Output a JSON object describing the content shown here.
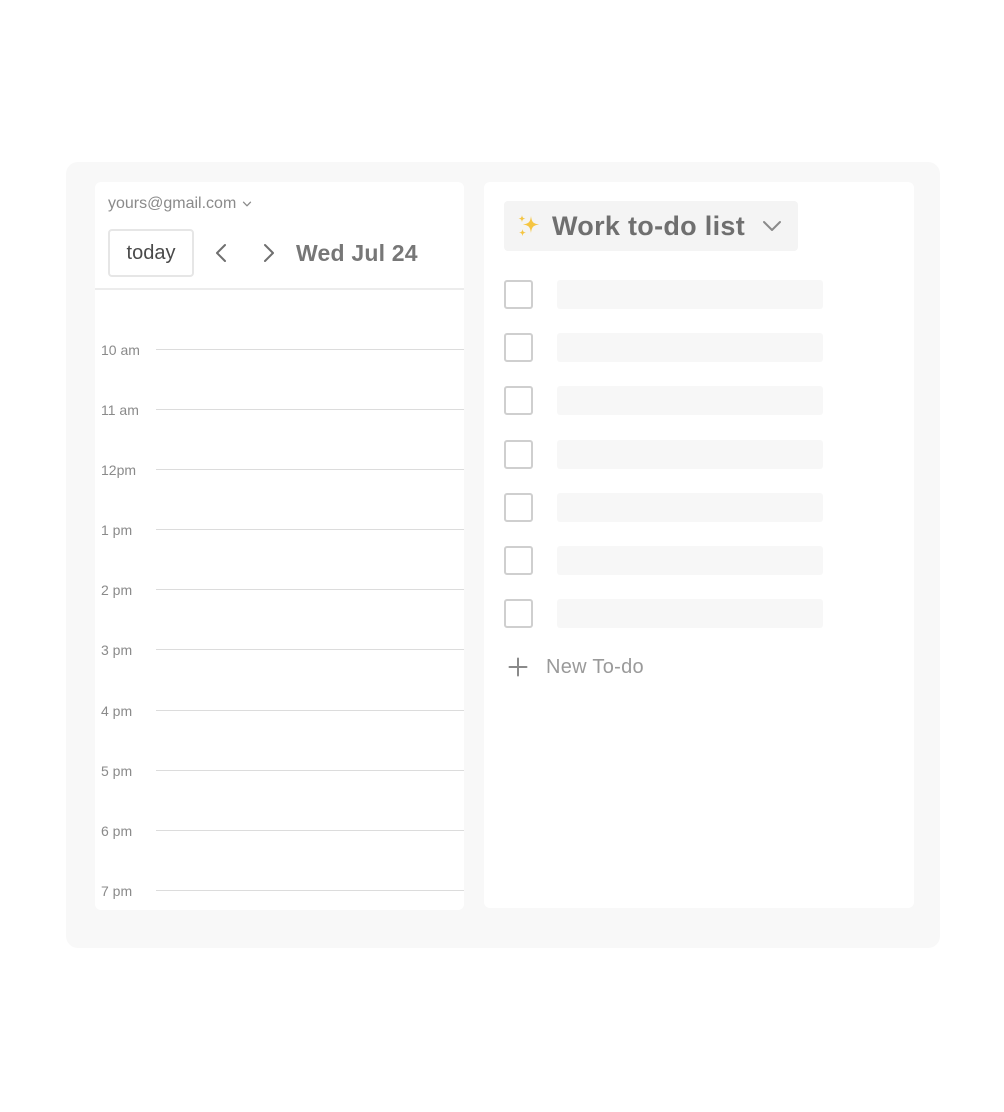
{
  "calendar": {
    "account": "yours@gmail.com",
    "today_label": "today",
    "date_label": "Wed Jul 24",
    "hours": [
      "10 am",
      "11 am",
      "12pm",
      "1 pm",
      "2 pm",
      "3 pm",
      "4 pm",
      "5 pm",
      "6 pm",
      "7 pm"
    ]
  },
  "todo": {
    "emoji": "✨",
    "title": "Work to-do list",
    "item_count": 7,
    "new_label": "New To-do"
  },
  "icons": {
    "account_dropdown": "chevron-down-icon",
    "prev": "chevron-left-icon",
    "next": "chevron-right-icon",
    "list_dropdown": "chevron-down-icon",
    "title_emoji": "sparkles-icon",
    "add": "plus-icon"
  },
  "colors": {
    "frame_bg": "#f8f8f8",
    "panel_bg": "#ffffff",
    "text_muted": "#8a8a8a",
    "title_text": "#6f6f6f",
    "sparkle": "#f5c542"
  }
}
